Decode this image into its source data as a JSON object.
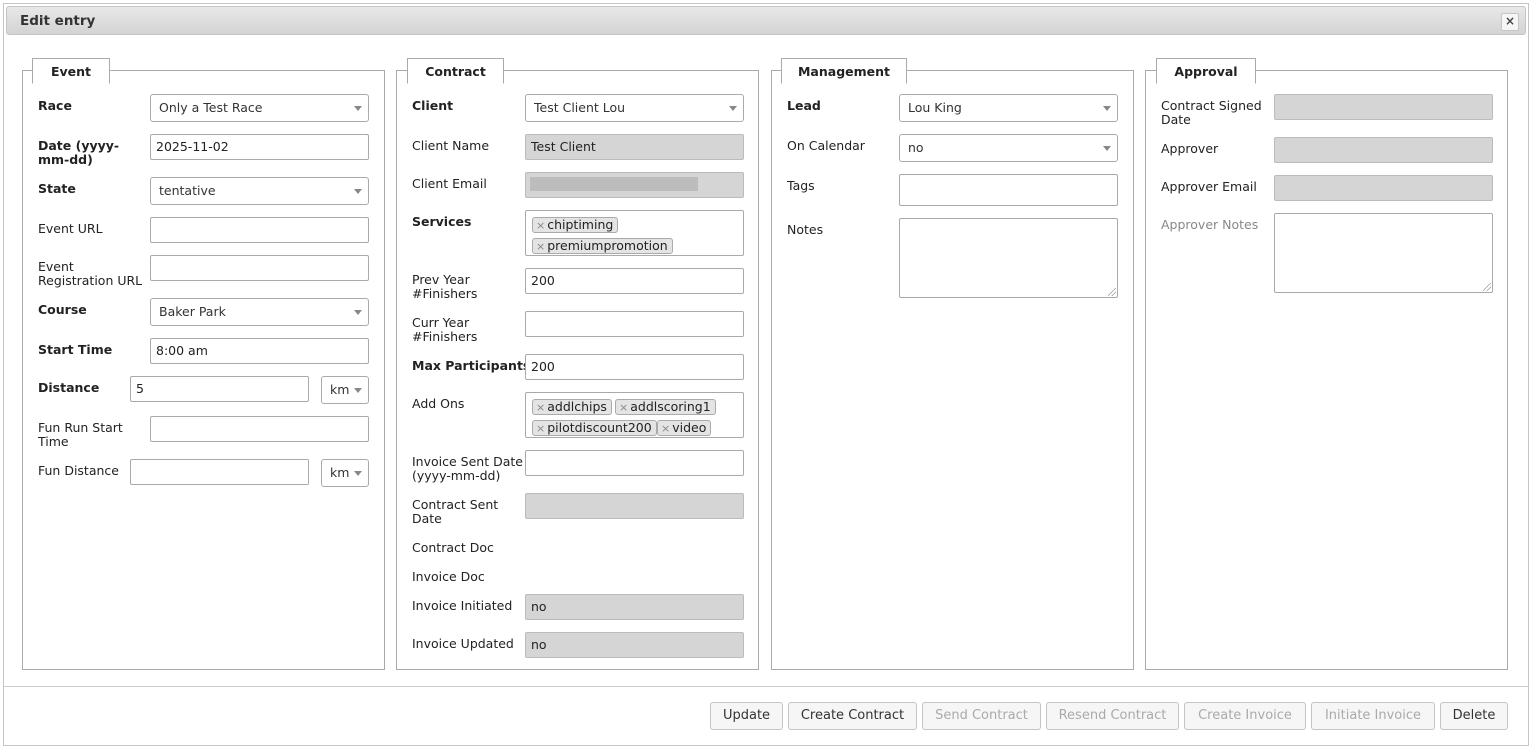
{
  "dialog": {
    "title": "Edit entry",
    "close_icon": "×"
  },
  "event": {
    "legend": "Event",
    "race_label": "Race",
    "race_value": "Only a Test Race",
    "date_label": "Date (yyyy-mm-dd)",
    "date_value": "2025-11-02",
    "state_label": "State",
    "state_value": "tentative",
    "event_url_label": "Event URL",
    "event_url_value": "",
    "reg_url_label": "Event Registration URL",
    "reg_url_value": "",
    "course_label": "Course",
    "course_value": "Baker Park",
    "start_time_label": "Start Time",
    "start_time_value": "8:00 am",
    "distance_label": "Distance",
    "distance_value": "5",
    "distance_unit": "km",
    "fun_start_label": "Fun Run Start Time",
    "fun_start_value": "",
    "fun_distance_label": "Fun Distance",
    "fun_distance_value": "",
    "fun_distance_unit": "km"
  },
  "contract": {
    "legend": "Contract",
    "client_label": "Client",
    "client_value": "Test Client Lou",
    "client_name_label": "Client Name",
    "client_name_value": "Test Client",
    "client_email_label": "Client Email",
    "services_label": "Services",
    "services": [
      "chiptiming",
      "premiumpromotion"
    ],
    "prev_label": "Prev Year #Finishers",
    "prev_value": "200",
    "curr_label": "Curr Year #Finishers",
    "curr_value": "",
    "max_label": "Max Participants",
    "max_value": "200",
    "addons_label": "Add Ons",
    "addons": [
      "addlchips",
      "addlscoring1",
      "pilotdiscount200",
      "video"
    ],
    "invoice_sent_label": "Invoice Sent Date (yyyy-mm-dd)",
    "invoice_sent_value": "",
    "contract_sent_label": "Contract Sent Date",
    "contract_sent_value": "",
    "contract_doc_label": "Contract Doc",
    "invoice_doc_label": "Invoice Doc",
    "invoice_initiated_label": "Invoice Initiated",
    "invoice_initiated_value": "no",
    "invoice_updated_label": "Invoice Updated",
    "invoice_updated_value": "no"
  },
  "management": {
    "legend": "Management",
    "lead_label": "Lead",
    "lead_value": "Lou King",
    "calendar_label": "On Calendar",
    "calendar_value": "no",
    "tags_label": "Tags",
    "tags_value": "",
    "notes_label": "Notes"
  },
  "approval": {
    "legend": "Approval",
    "signed_label": "Contract Signed Date",
    "approver_label": "Approver",
    "approver_email_label": "Approver Email",
    "approver_notes_label": "Approver Notes"
  },
  "buttons": {
    "update": "Update",
    "create_contract": "Create Contract",
    "send_contract": "Send Contract",
    "resend_contract": "Resend Contract",
    "create_invoice": "Create Invoice",
    "initiate_invoice": "Initiate Invoice",
    "delete": "Delete"
  }
}
